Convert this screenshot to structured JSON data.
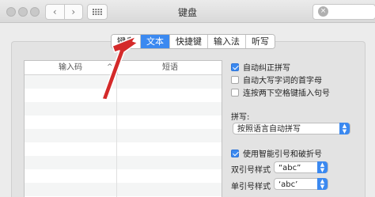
{
  "window": {
    "title": "键盘"
  },
  "toolbar": {
    "back_label": "‹",
    "forward_label": "›",
    "search_clear": "×"
  },
  "tabs": [
    {
      "label": "键盘",
      "selected": false
    },
    {
      "label": "文本",
      "selected": true
    },
    {
      "label": "快捷键",
      "selected": false
    },
    {
      "label": "输入法",
      "selected": false
    },
    {
      "label": "听写",
      "selected": false
    }
  ],
  "table": {
    "columns": [
      "输入码",
      "短语"
    ],
    "sort_indicator": "^"
  },
  "options": {
    "autocorrect": {
      "label": "自动纠正拼写",
      "checked": true
    },
    "capitalize": {
      "label": "自动大写字词的首字母",
      "checked": false
    },
    "period": {
      "label": "连按两下空格键插入句号",
      "checked": false
    },
    "smart_quotes": {
      "label": "使用智能引号和破折号",
      "checked": true
    }
  },
  "spelling": {
    "label": "拼写:",
    "value": "按照语言自动拼写"
  },
  "quotes": {
    "double_label": "双引号样式",
    "double_value": "“abc”",
    "single_label": "单引号样式",
    "single_value": "‘abc’"
  },
  "colors": {
    "accent": "#3b89f0",
    "annotation_arrow": "#d42a2a"
  }
}
